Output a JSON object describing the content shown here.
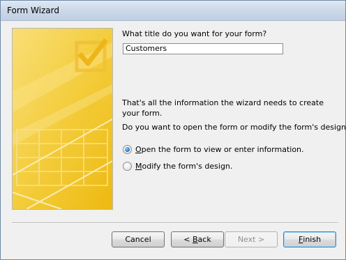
{
  "window": {
    "title": "Form Wizard"
  },
  "form": {
    "prompt": "What title do you want for your form?",
    "title_value": "Customers",
    "info": "That's all the information the wizard needs to create your form.",
    "question": "Do you want to open the form or modify the form's design?",
    "options": [
      {
        "label_prefix": "",
        "mnemonic": "O",
        "label_rest": "pen the form to view or enter information.",
        "checked": true
      },
      {
        "label_prefix": "",
        "mnemonic": "M",
        "label_rest": "odify the form's design.",
        "checked": false
      }
    ]
  },
  "buttons": {
    "cancel": "Cancel",
    "back_prefix": "< ",
    "back_mnemonic": "B",
    "back_rest": "ack",
    "next": "Next >",
    "finish_mnemonic": "F",
    "finish_rest": "inish"
  },
  "colors": {
    "art_yellow": "#f7c928",
    "art_light": "#fde680",
    "window_bg": "#f0f0f0"
  }
}
